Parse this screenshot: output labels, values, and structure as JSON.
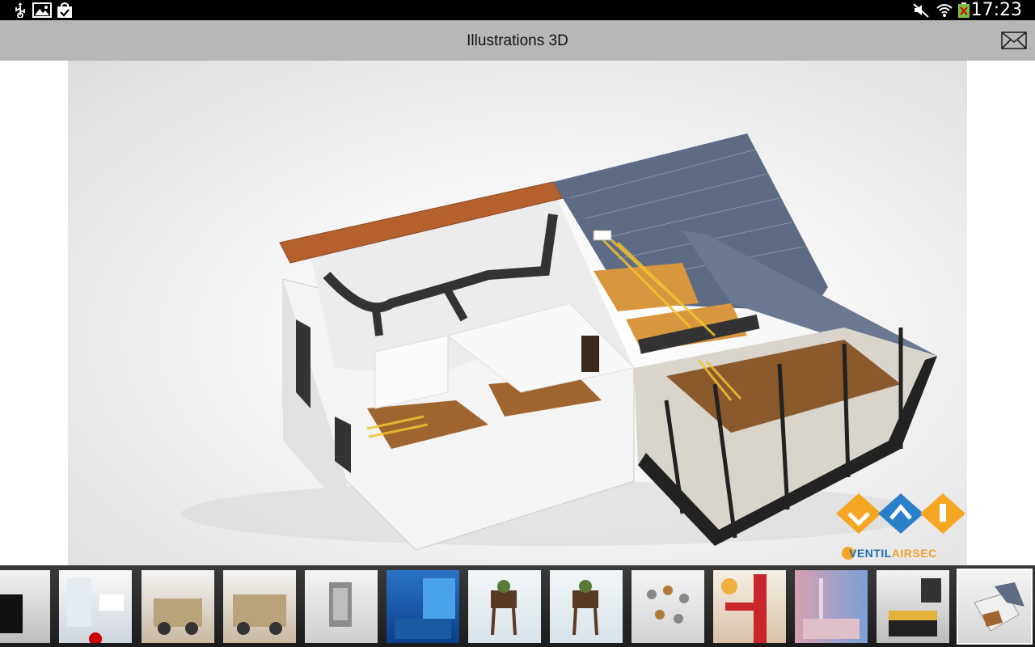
{
  "status_bar": {
    "left_icons": [
      "usb-icon",
      "image-icon",
      "shopping-bag-check-icon"
    ],
    "right_icons": [
      "mute-icon",
      "wifi-icon",
      "battery-icon"
    ],
    "time": "17:23"
  },
  "action_bar": {
    "title": "Illustrations 3D",
    "mail_icon": "mail-icon"
  },
  "viewer": {
    "subject": "3D cutaway house illustration",
    "brand_name_a": "VENTIL",
    "brand_name_b": "AIRSEC"
  },
  "thumbnails": {
    "selected_index": 12,
    "items": [
      "Black device",
      "Bathroom",
      "Armored vehicle",
      "Armored vehicle front",
      "Grey panel",
      "Blue room",
      "Wooden planter",
      "Wooden planter",
      "Fittings",
      "Red piping",
      "Pink interior",
      "Kitchen",
      "House cutaway"
    ]
  },
  "colors": {
    "status_bar": "#000000",
    "action_bar": "#b7b7b7",
    "strip": "#2a2a2a",
    "brand_orange": "#f5a623",
    "brand_blue": "#2a7fc9"
  }
}
